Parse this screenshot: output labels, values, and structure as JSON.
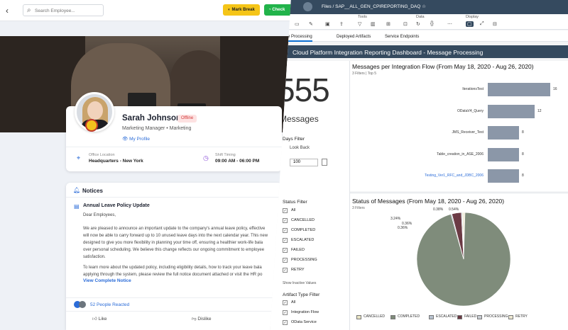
{
  "left": {
    "search": {
      "placeholder": "Search Employee..."
    },
    "buttons": {
      "mark_break": "Mark Break",
      "check": "Check"
    },
    "profile": {
      "name": "Sarah Johnson",
      "status": "Offline",
      "role": "Marketing Manager • Marketing",
      "link": "My Profile",
      "office_label": "Office Location",
      "office_value": "Headquarters - New York",
      "shift_label": "Shift Timing",
      "shift_value": "09:00 AM - 06:00 PM"
    },
    "notices": {
      "title": "Notices",
      "item_title": "Annual Leave Policy Update",
      "greeting": "Dear Employees,",
      "para1": [
        "We are pleased to announce an important update to the company's annual leave policy, effective",
        "will now be able to carry forward up to 10 unused leave days into the next calendar year. This new",
        "designed to give you more flexibility in planning your time off, ensuring a healthier work-life bala",
        "over personal scheduling. We believe this change reflects our ongoing commitment to employee",
        "satisfaction."
      ],
      "para2": [
        "To learn more about the updated policy, including eligibility details, how to track your leave bala",
        "applying through the system, please review the full notice document attached or visit the HR po"
      ],
      "view_more": "View Complete Notice",
      "reactions": "52 People Reacted",
      "like": "Like",
      "dislike": "Dislike"
    }
  },
  "right": {
    "breadcrumb": "Files  /  SAP__ALL_GEN_CPIREPORTING_DAQ",
    "toolbar_groups": {
      "tools": "Tools",
      "data": "Data",
      "display": "Display"
    },
    "tabs": [
      "Message Processing",
      "Deployed Artifacts",
      "Service Endpoints"
    ],
    "dashboard_title": "Cloud Platform Integration Reporting Dashboard - Message Processing",
    "kpi": {
      "value": "555",
      "label": "Messages"
    },
    "days_filter": {
      "title": "Days Filter",
      "sublabel": "Look Back",
      "value": "100"
    },
    "status_filter": {
      "title": "Status Filter",
      "items": [
        "All",
        "CANCELLED",
        "COMPLETED",
        "ESCALATED",
        "FAILED",
        "PROCESSING",
        "RETRY"
      ],
      "show_inactive": "Show Inactive Values"
    },
    "artifact_filter": {
      "title": "Artifact Type Filter",
      "items": [
        "All",
        "Integration Flow",
        "OData Service"
      ]
    }
  },
  "chart_data": [
    {
      "type": "bar",
      "title": "Messages per Integration Flow (From May 18, 2020 - Aug 26, 2020)",
      "subtitle": "3 Filters | Top 5",
      "categories": [
        "IterationsTest",
        "ODataV4_Query",
        "JMS_Receiver_Test",
        "Table_creation_in_ASE_2006",
        "Testing_Ver1_RFC_and_JDBC_2006"
      ],
      "values": [
        16,
        12,
        8,
        8,
        8
      ],
      "xlim": [
        0,
        16
      ]
    },
    {
      "type": "pie",
      "title": "Status of Messages (From May 18, 2020 - Aug 26, 2020)",
      "subtitle": "3 Filters",
      "categories": [
        "CANCELLED",
        "COMPLETED",
        "ESCALATED",
        "FAILED",
        "PROCESSING",
        "RETRY"
      ],
      "values": [
        0.36,
        95.14,
        0.36,
        3.24,
        0.36,
        0.54
      ],
      "colors": [
        "#e8e3c4",
        "#7f8c7b",
        "#b7c2ce",
        "#6b3a44",
        "#c9cdd3",
        "#ebe7d1"
      ],
      "slice_labels": [
        "0.36%",
        "95.14%",
        "0.36%",
        "3.24%",
        "0.38%",
        "0.54%"
      ]
    }
  ]
}
